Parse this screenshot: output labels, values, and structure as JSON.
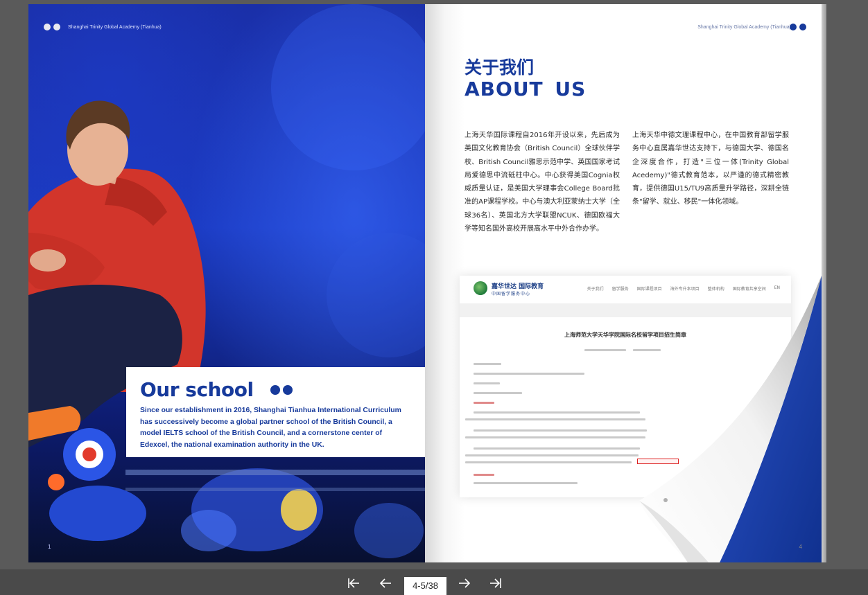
{
  "book": {
    "header": "Shanghai Trinity Global Academy (Tianhua)"
  },
  "left_page": {
    "school_title": "Our school",
    "school_text": "Since our establishment in 2016, Shanghai Tianhua International Curriculum has successively become a global partner school of the British Council, a model IELTS school of the British Council, and a cornerstone center of Edexcel, the national examination authority in the UK.",
    "page_number": "1"
  },
  "right_page": {
    "title_cn": "关于我们",
    "title_en": "ABOUT US",
    "body_cn_1": "上海天华国际课程自2016年开设以来，先后成为英国文化教育协会（British Council）全球伙伴学校、British Council雅思示范中学、英国国家考试局爱德思中流砥柱中心。中心获得美国Cognia权威质量认证，是美国大学理事会College Board批准的AP课程学校。中心与澳大利亚蒙纳士大学（全球36名）、英国北方大学联盟NCUK、德国欧福大学等知名国外高校开展高水平中外合作办学。",
    "body_cn_2": "上海天华中德文理课程中心，在中国教育部留学服务中心直属嘉华世达支持下，与德国大学、德国名企深度合作，打造\"三位一体(Trinity Global Acedemy)\"德式教育范本，以严谨的德式精密教育，提供德国U15/TU9高质量升学路径，深耕全链条\"留学、就业、移民\"一体化领域。",
    "page_number": "4",
    "web_screenshot": {
      "logo_name": "嘉华世达 国际教育",
      "logo_sub": "中国留学服务中心",
      "menu": [
        "关于我们",
        "留学服务",
        "国际课程项目",
        "海外专升本项目",
        "整体机构",
        "国际教育共享空间",
        "EN"
      ],
      "article_title": "上海师范大学天华学院国际名校留学项目招生简章"
    }
  },
  "toolbar": {
    "page_indicator": "4-5/38"
  },
  "colors": {
    "brand_blue": "#173a9b",
    "toolbar_bg": "#4a4a4a",
    "viewer_bg": "#5a5a5a"
  },
  "icons": {
    "first": "skip-first-icon",
    "prev": "arrow-left-icon",
    "next": "arrow-right-icon",
    "last": "skip-last-icon"
  }
}
